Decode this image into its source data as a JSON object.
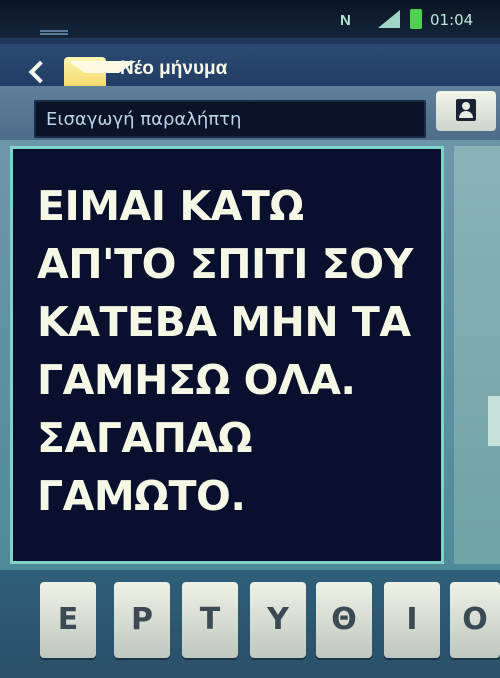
{
  "status_bar": {
    "nfc": "N",
    "time": "01:04"
  },
  "header": {
    "title": "Νέο μήνυμα"
  },
  "recipient": {
    "placeholder": "Εισαγωγή παραλήπτη"
  },
  "message": {
    "text": "ΕΙΜΑΙ ΚΑΤΩ\nΑΠ'ΤΟ ΣΠΙΤΙ ΣΟΥ\nΚΑΤΕΒΑ ΜΗΝ ΤΑ\nΓΑΜΗΣΩ ΟΛΑ.\nΣΑΓΑΠΑΩ\nΓΑΜΩΤΟ."
  },
  "keyboard": {
    "keys": [
      "Ε",
      "Ρ",
      "Τ",
      "Υ",
      "Θ",
      "Ι",
      "Ο"
    ]
  },
  "colors": {
    "message_bg": "#08102e",
    "message_border": "#7fd3c8",
    "battery": "#4ed14e"
  }
}
